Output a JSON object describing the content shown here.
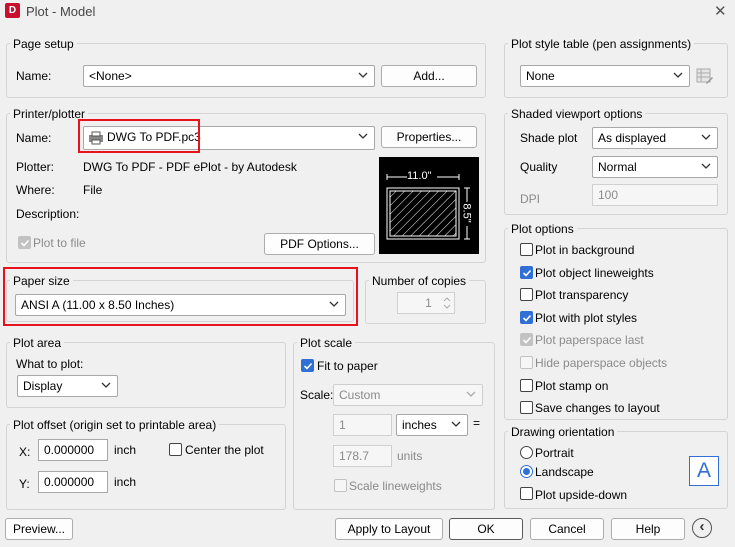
{
  "window": {
    "app_icon_letter": "D",
    "title": "Plot - Model",
    "close_glyph": "✕"
  },
  "page_setup": {
    "legend": "Page setup",
    "name_label": "Name:",
    "name_value": "<None>",
    "add_button": "Add..."
  },
  "printer": {
    "legend": "Printer/plotter",
    "name_label": "Name:",
    "name_value": "DWG To PDF.pc3",
    "properties_button": "Properties...",
    "plotter_label": "Plotter:",
    "plotter_value": "DWG To PDF - PDF ePlot - by Autodesk",
    "where_label": "Where:",
    "where_value": "File",
    "description_label": "Description:",
    "plot_to_file_label": "Plot to file",
    "pdf_options_button": "PDF Options...",
    "preview_width": "11.0\"",
    "preview_height": "8.5\""
  },
  "paper_size": {
    "legend": "Paper size",
    "value": "ANSI A (11.00 x 8.50 Inches)"
  },
  "copies": {
    "legend": "Number of copies",
    "value": "1"
  },
  "plot_area": {
    "legend": "Plot area",
    "what_label": "What to plot:",
    "what_value": "Display"
  },
  "plot_offset": {
    "legend": "Plot offset (origin set to printable area)",
    "x_label": "X:",
    "x_value": "0.000000",
    "x_unit": "inch",
    "y_label": "Y:",
    "y_value": "0.000000",
    "y_unit": "inch",
    "center_label": "Center the plot"
  },
  "plot_scale": {
    "legend": "Plot scale",
    "fit_label": "Fit to paper",
    "scale_label": "Scale:",
    "scale_value": "Custom",
    "value1": "1",
    "unit1": "inches",
    "equals": "=",
    "value2": "178.7",
    "unit2": "units",
    "scale_lineweights_label": "Scale lineweights"
  },
  "plot_style_table": {
    "legend": "Plot style table (pen assignments)",
    "value": "None"
  },
  "shaded_viewport": {
    "legend": "Shaded viewport options",
    "shade_label": "Shade plot",
    "shade_value": "As displayed",
    "quality_label": "Quality",
    "quality_value": "Normal",
    "dpi_label": "DPI",
    "dpi_value": "100"
  },
  "plot_options": {
    "legend": "Plot options",
    "items": [
      {
        "label": "Plot in background",
        "checked": false,
        "disabled": false
      },
      {
        "label": "Plot object lineweights",
        "checked": true,
        "disabled": false
      },
      {
        "label": "Plot transparency",
        "checked": false,
        "disabled": false
      },
      {
        "label": "Plot with plot styles",
        "checked": true,
        "disabled": false
      },
      {
        "label": "Plot paperspace last",
        "checked": true,
        "disabled": true
      },
      {
        "label": "Hide paperspace objects",
        "checked": false,
        "disabled": true
      },
      {
        "label": "Plot stamp on",
        "checked": false,
        "disabled": false
      },
      {
        "label": "Save changes to layout",
        "checked": false,
        "disabled": false
      }
    ]
  },
  "orientation": {
    "legend": "Drawing orientation",
    "portrait_label": "Portrait",
    "landscape_label": "Landscape",
    "upside_down_label": "Plot upside-down",
    "icon_letter": "A"
  },
  "footer": {
    "preview_button": "Preview...",
    "apply_button": "Apply to Layout",
    "ok_button": "OK",
    "cancel_button": "Cancel",
    "help_button": "Help",
    "expand_glyph": "‹"
  },
  "colors": {
    "accent": "#2f6fd6",
    "highlight_box": "#e8121c"
  }
}
